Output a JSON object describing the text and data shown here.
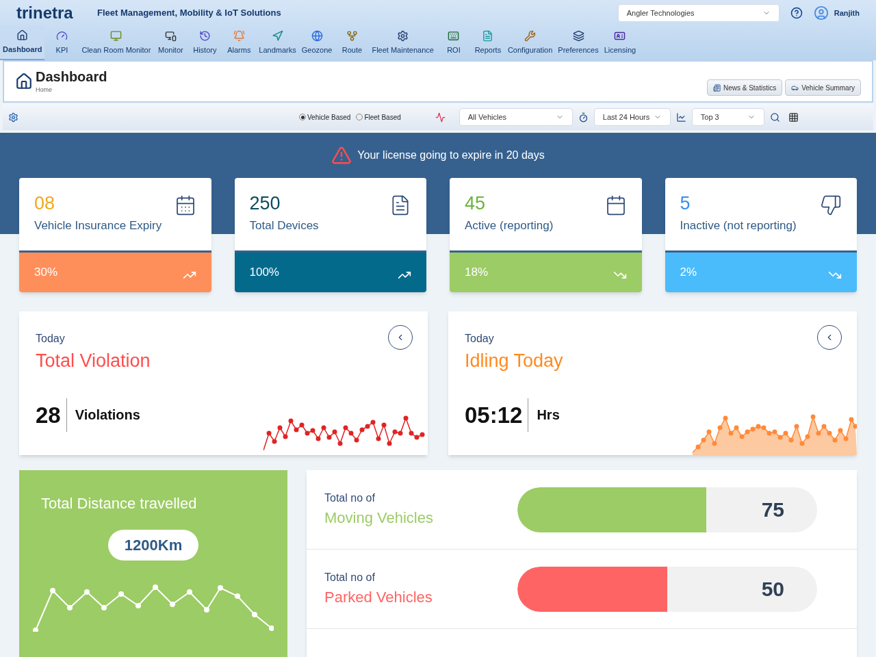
{
  "header": {
    "logo": "trinetra",
    "tagline": "Fleet Management, Mobility & IoT Solutions",
    "company": "Angler Technologies",
    "user": "Ranjith"
  },
  "nav": [
    {
      "label": "Dashboard",
      "selected": true
    },
    {
      "label": "KPI",
      "selected": false
    },
    {
      "label": "Clean Room Monitor",
      "selected": false
    },
    {
      "label": "Monitor",
      "selected": false
    },
    {
      "label": "History",
      "selected": false
    },
    {
      "label": "Alarms",
      "selected": false
    },
    {
      "label": "Landmarks",
      "selected": false
    },
    {
      "label": "Geozone",
      "selected": false
    },
    {
      "label": "Route",
      "selected": false
    },
    {
      "label": "Fleet Maintenance",
      "selected": false
    },
    {
      "label": "ROI",
      "selected": false
    },
    {
      "label": "Reports",
      "selected": false
    },
    {
      "label": "Configuration",
      "selected": false
    },
    {
      "label": "Preferences",
      "selected": false
    },
    {
      "label": "Licensing",
      "selected": false
    }
  ],
  "page": {
    "title": "Dashboard",
    "breadcrumb": "Home",
    "buttons": [
      "News & Statistics",
      "Vehicle Summary"
    ]
  },
  "toolbar": {
    "radios": [
      {
        "label": "Vehicle Based",
        "selected": true
      },
      {
        "label": "Fleet Based",
        "selected": false
      }
    ],
    "vehicles": "All Vehicles",
    "period": "Last 24 Hours",
    "top": "Top 3"
  },
  "alert": "Your license going to expire in 20 days",
  "stats": [
    {
      "value": "08",
      "label": "Vehicle Insurance Expiry",
      "percent": "30%",
      "color": "#ff8f5a",
      "kind": "up"
    },
    {
      "value": "250",
      "label": "Total Devices",
      "percent": "100%",
      "color": "#036a8c",
      "kind": "up"
    },
    {
      "value": "45",
      "label": "Active (reporting)",
      "percent": "18%",
      "color": "#9ccc65",
      "kind": "down"
    },
    {
      "value": "5",
      "label": "Inactive (not reporting)",
      "percent": "2%",
      "color": "#4bbcfb",
      "kind": "down"
    }
  ],
  "today": [
    {
      "caption": "Today",
      "title": "Total Violation",
      "value": "28",
      "unit": "Violations",
      "kind": "violation"
    },
    {
      "caption": "Today",
      "title": "Idling Today",
      "value": "05:12",
      "unit": "Hrs",
      "kind": "idling"
    }
  ],
  "distance": {
    "title": "Total Distance travelled",
    "value": "1200Km"
  },
  "vehicles": [
    {
      "caption": "Total no of",
      "title": "Moving Vehicles",
      "value": "75",
      "level": 0.63,
      "color": "#9ccc65"
    },
    {
      "caption": "Total no of",
      "title": "Parked Vehicles",
      "value": "50",
      "level": 0.5,
      "color": "#ff6464"
    }
  ]
}
